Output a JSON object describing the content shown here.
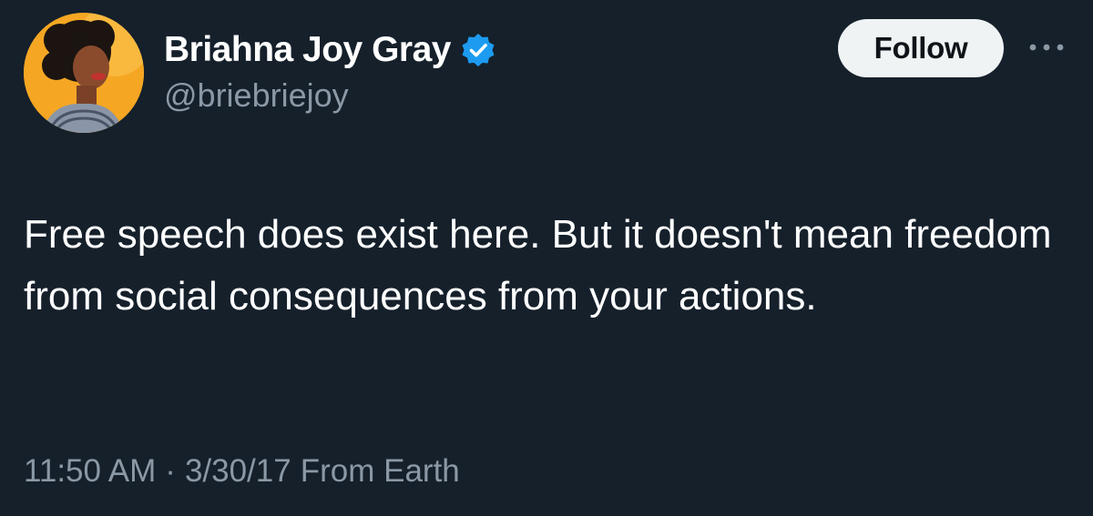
{
  "author": {
    "display_name": "Briahna Joy Gray",
    "handle": "@briebriejoy",
    "verified_icon": "verified-badge-icon",
    "avatar_icon": "profile-photo"
  },
  "actions": {
    "follow_label": "Follow",
    "more_icon": "more-dots-icon"
  },
  "tweet": {
    "text": "Free speech does exist here. But it doesn't mean freedom from social consequences from your actions.",
    "time": "11:50 AM",
    "separator": "·",
    "date": "3/30/17",
    "source": "From Earth"
  },
  "colors": {
    "background": "#15202b",
    "text": "#ffffff",
    "secondary_text": "#8b98a5",
    "verified_blue": "#1d9bf0",
    "follow_button_bg": "#eff3f4"
  }
}
